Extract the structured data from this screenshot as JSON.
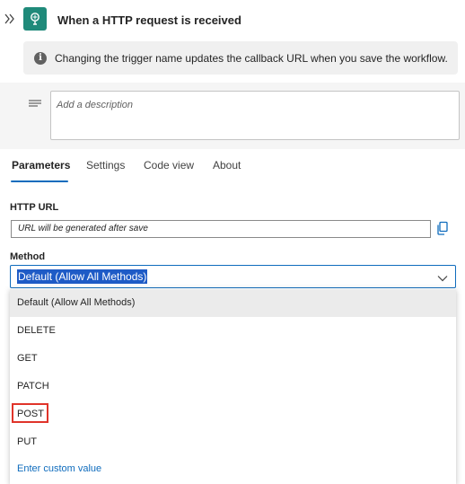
{
  "header": {
    "title": "When a HTTP request is received",
    "expand_icon": "double-chevron-right-icon",
    "trigger_icon": "http-request-icon"
  },
  "info": {
    "icon": "info-icon",
    "text": "Changing the trigger name updates the callback URL when you save the workflow."
  },
  "description": {
    "icon": "description-lines-icon",
    "placeholder": "Add a description"
  },
  "tabs": [
    {
      "label": "Parameters",
      "active": true
    },
    {
      "label": "Settings",
      "active": false
    },
    {
      "label": "Code view",
      "active": false
    },
    {
      "label": "About",
      "active": false
    }
  ],
  "http_url": {
    "label": "HTTP URL",
    "value": "URL will be generated after save",
    "copy_icon": "copy-icon"
  },
  "method": {
    "label": "Method",
    "selected": "Default (Allow All Methods)",
    "chevron_icon": "chevron-down-icon",
    "options": [
      "Default (Allow All Methods)",
      "DELETE",
      "GET",
      "PATCH",
      "POST",
      "PUT"
    ],
    "custom_option": "Enter custom value",
    "highlighted_option": "POST"
  },
  "colors": {
    "accent": "#0f6cbd",
    "trigger_icon_bg": "#1f8a7a",
    "highlight_border": "#e0342a",
    "selection_bg": "#1e5bc6"
  }
}
